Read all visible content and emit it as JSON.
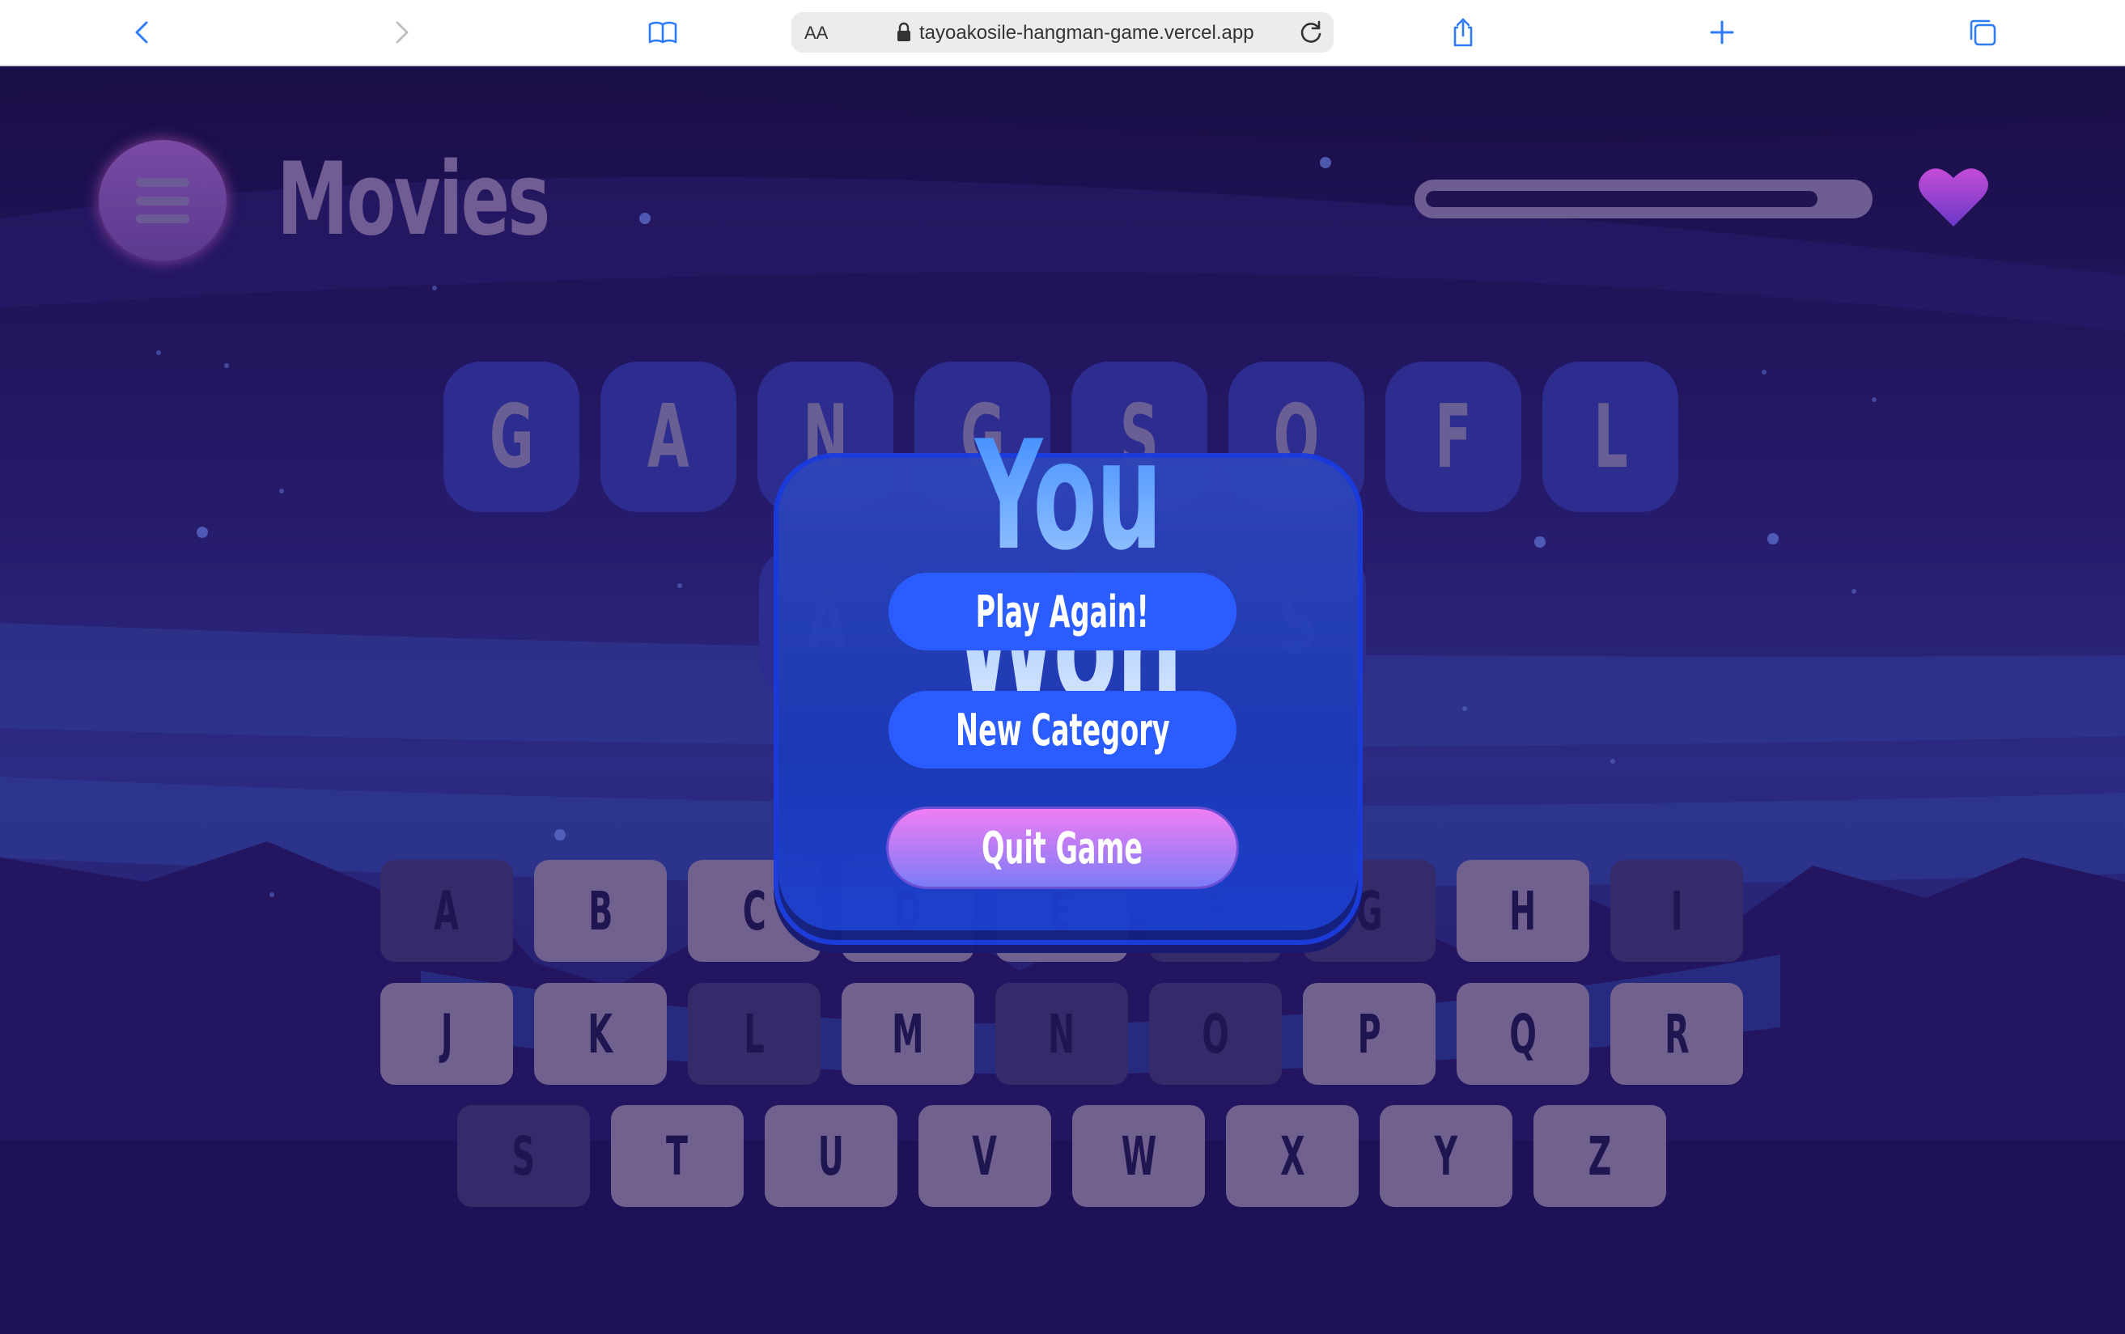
{
  "browser": {
    "url": "tayoakosile-hangman-game.vercel.app",
    "text_size_label": "AA",
    "icons": [
      "back-icon",
      "forward-icon",
      "bookmarks-icon",
      "lock-icon",
      "reload-icon",
      "share-icon",
      "new-tab-icon",
      "tabs-icon"
    ]
  },
  "header": {
    "category": "Movies",
    "health_fraction": 0.9
  },
  "word": {
    "row1": [
      {
        "letter": "G",
        "revealed": true
      },
      {
        "letter": "A",
        "revealed": true
      },
      {
        "letter": "N",
        "revealed": true
      },
      {
        "letter": "G",
        "revealed": true
      },
      {
        "letter": "S",
        "revealed": true
      },
      {
        "letter": "O",
        "revealed": true
      },
      {
        "letter": "F",
        "revealed": true
      },
      {
        "letter": "L",
        "revealed": true
      }
    ],
    "row2": [
      {
        "letter": "A",
        "revealed": true
      },
      {
        "letter": "",
        "revealed": false
      },
      {
        "letter": "",
        "revealed": false
      },
      {
        "letter": "S",
        "revealed": true
      }
    ]
  },
  "keyboard": {
    "row1": [
      {
        "key": "A",
        "used": true
      },
      {
        "key": "B",
        "used": false
      },
      {
        "key": "C",
        "used": false
      },
      {
        "key": "D",
        "used": false
      },
      {
        "key": "E",
        "used": false
      },
      {
        "key": "F",
        "used": true
      },
      {
        "key": "G",
        "used": true
      },
      {
        "key": "H",
        "used": false
      },
      {
        "key": "I",
        "used": true
      }
    ],
    "row2": [
      {
        "key": "J",
        "used": false
      },
      {
        "key": "K",
        "used": false
      },
      {
        "key": "L",
        "used": true
      },
      {
        "key": "M",
        "used": false
      },
      {
        "key": "N",
        "used": true
      },
      {
        "key": "O",
        "used": true
      },
      {
        "key": "P",
        "used": false
      },
      {
        "key": "Q",
        "used": false
      },
      {
        "key": "R",
        "used": false
      }
    ],
    "row3": [
      {
        "key": "S",
        "used": true
      },
      {
        "key": "T",
        "used": false
      },
      {
        "key": "U",
        "used": false
      },
      {
        "key": "V",
        "used": false
      },
      {
        "key": "W",
        "used": false
      },
      {
        "key": "X",
        "used": false
      },
      {
        "key": "Y",
        "used": false
      },
      {
        "key": "Z",
        "used": false
      }
    ]
  },
  "modal": {
    "title": "You Won",
    "play_again": "Play Again!",
    "new_category": "New Category",
    "quit": "Quit Game"
  },
  "colors": {
    "background": "#1e1150",
    "primary_button": "#2a5cff",
    "quit_gradient_top": "#f07df3",
    "quit_gradient_bottom": "#7b7cf6",
    "heart_top": "#c34bd6",
    "heart_bottom": "#6a39c8"
  }
}
